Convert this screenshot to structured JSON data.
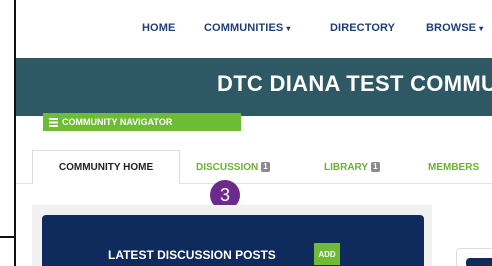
{
  "topnav": {
    "items": [
      {
        "label": "HOME"
      },
      {
        "label": "COMMUNITIES",
        "caret": "▾"
      },
      {
        "label": "DIRECTORY"
      },
      {
        "label": "BROWSE",
        "caret": "▾"
      }
    ]
  },
  "banner": {
    "title": "DTC DIANA TEST COMMUNITY",
    "bg_color": "#2e5863"
  },
  "navigator": {
    "label": "COMMUNITY NAVIGATOR",
    "icon": "list-icon",
    "color": "#6dbb36"
  },
  "tabs": [
    {
      "label": "COMMUNITY HOME",
      "badge": ""
    },
    {
      "label": "DISCUSSION",
      "badge": "1"
    },
    {
      "label": "LIBRARY",
      "badge": "1"
    },
    {
      "label": "MEMBERS",
      "badge": ""
    }
  ],
  "step_marker": {
    "number": "3",
    "color": "#6b2a8c"
  },
  "panel": {
    "title": "LATEST DISCUSSION POSTS",
    "add_label": "ADD",
    "bg_color": "#0f2a5c"
  },
  "accent_color": "#6dae3a"
}
